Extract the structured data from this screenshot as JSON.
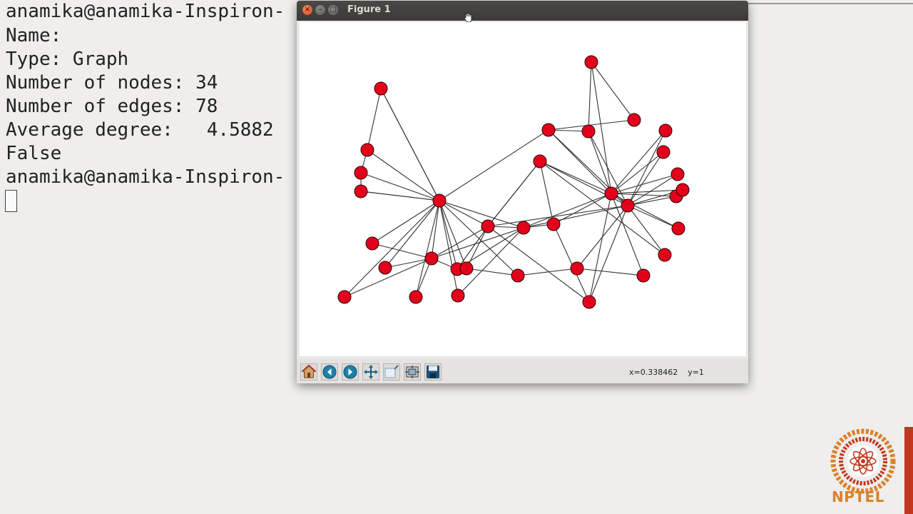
{
  "terminal": {
    "lines": [
      "anamika@anamika-Inspiron-",
      "Name:",
      "Type: Graph",
      "Number of nodes: 34",
      "Number of edges: 78",
      "Average degree:   4.5882",
      "False",
      "anamika@anamika-Inspiron-"
    ]
  },
  "figure_window": {
    "title": "Figure 1",
    "close_glyph": "×",
    "min_glyph": "–",
    "max_glyph": "□",
    "toolbar": {
      "icons": [
        "home-icon",
        "back-icon",
        "forward-icon",
        "pan-icon",
        "zoom-icon",
        "subplots-icon",
        "save-icon"
      ],
      "coords": "x=0.338462    y=1"
    }
  },
  "graph": {
    "node_color": "#e3001b",
    "edge_color": "#333333",
    "node_count": 34,
    "edge_count": 78
  },
  "logo": {
    "text": "NPTEL",
    "color": "#d9822b"
  }
}
